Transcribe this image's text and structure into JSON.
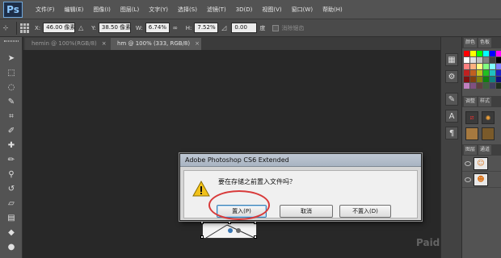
{
  "app": {
    "logo_text": "Ps"
  },
  "menu": [
    "文件(F)",
    "编辑(E)",
    "图像(I)",
    "图层(L)",
    "文字(Y)",
    "选择(S)",
    "滤镜(T)",
    "3D(D)",
    "视图(V)",
    "窗口(W)",
    "帮助(H)"
  ],
  "options": {
    "x_label": "X:",
    "x_value": "46.00 像素",
    "delta_symbol": "△",
    "y_label": "Y:",
    "y_value": "38.50 像素",
    "w_label": "W:",
    "w_value": "6.74%",
    "link_symbol": "∞",
    "h_label": "H:",
    "h_value": "7.52%",
    "angle_symbol": "◿",
    "angle_value": "0.00",
    "degree_symbol": "度",
    "interp_label": "消除锯齿"
  },
  "tabs": [
    {
      "label": "hemin @ 100%(RGB/8)",
      "close": "×",
      "active": false
    },
    {
      "label": "hm @ 100% (333, RGB/8)",
      "close": "×",
      "active": true
    }
  ],
  "panels": {
    "tab_a": "颜色",
    "tab_b": "色板",
    "tab_c": "调整",
    "tab_d": "样式",
    "tab_e": "图层",
    "tab_f": "通道"
  },
  "swatch_colors": [
    "#ff0000",
    "#ffff00",
    "#00ff00",
    "#00ffff",
    "#0000ff",
    "#ff00ff",
    "#ffffff",
    "#e0e0e0",
    "#c0c0c0",
    "#808080",
    "#404040",
    "#000000",
    "#ff8080",
    "#ffb080",
    "#ffff80",
    "#80ff80",
    "#80ffff",
    "#8080ff",
    "#c02020",
    "#c06020",
    "#c0c020",
    "#20c020",
    "#20c0c0",
    "#2020c0",
    "#801010",
    "#804010",
    "#808010",
    "#108010",
    "#108080",
    "#101080",
    "#c080c0",
    "#805080",
    "#604040",
    "#406040",
    "#404060",
    "#203020"
  ],
  "dialog": {
    "title": "Adobe Photoshop CS6 Extended",
    "message": "要在存储之前置入文件吗？",
    "btn_place": "置入(P)",
    "btn_cancel": "取消",
    "btn_dont_place": "不置入(D)"
  },
  "watermark": "Paid"
}
